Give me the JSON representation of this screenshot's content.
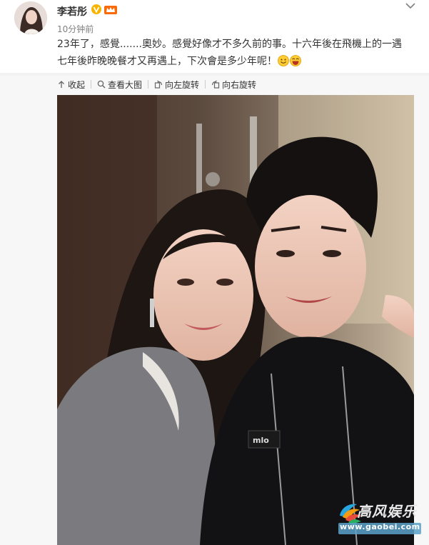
{
  "user": {
    "name": "李若彤",
    "time": "10分钟前"
  },
  "post": {
    "line1": "23年了，感覺.......奧妙。感覺好像才不多久前的事。十六年後在飛機上的一遇",
    "line2": "七年後昨晚晚餐才又再遇上，下次會是多少年呢！"
  },
  "toolbar": {
    "collapse": "收起",
    "view_large": "查看大图",
    "rotate_left": "向左旋转",
    "rotate_right": "向右旋转"
  },
  "watermark": {
    "logo_text": "高风娱乐",
    "url": "www.gaobei.com"
  },
  "colors": {
    "accent": "#f7b500",
    "link": "#333333",
    "muted": "#808080"
  }
}
